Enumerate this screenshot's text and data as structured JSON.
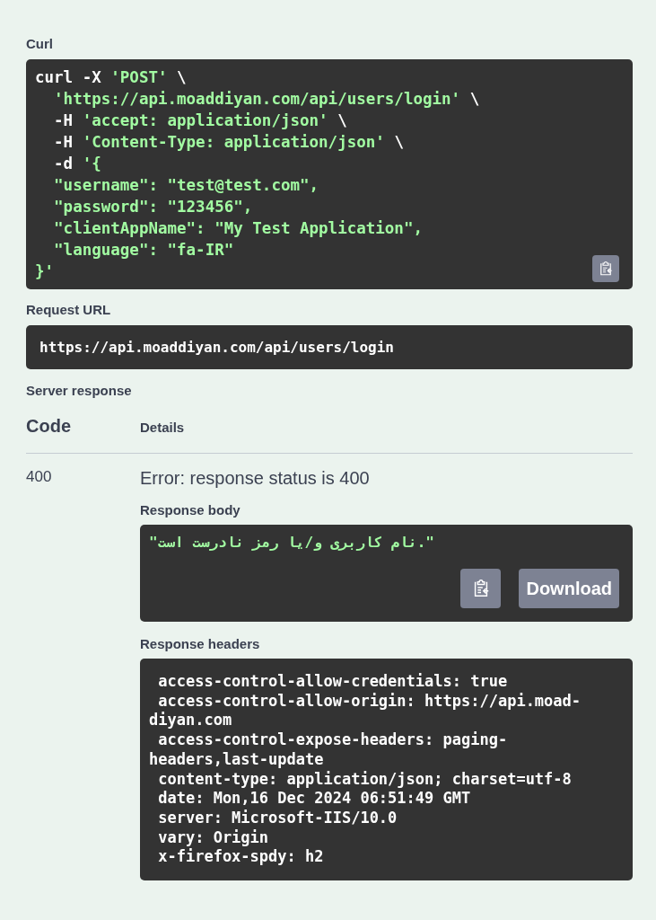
{
  "curl": {
    "label": "Curl",
    "lines": [
      [
        {
          "kind": "plain",
          "text": "curl -X "
        },
        {
          "kind": "string",
          "text": "'POST'"
        },
        {
          "kind": "plain",
          "text": " \\"
        }
      ],
      [
        {
          "kind": "string",
          "text": "  'https://api.moaddiyan.com/api/users/login'"
        },
        {
          "kind": "plain",
          "text": " \\"
        }
      ],
      [
        {
          "kind": "plain",
          "text": "  -H "
        },
        {
          "kind": "string",
          "text": "'accept: application/json'"
        },
        {
          "kind": "plain",
          "text": " \\"
        }
      ],
      [
        {
          "kind": "plain",
          "text": "  -H "
        },
        {
          "kind": "string",
          "text": "'Content-Type: application/json'"
        },
        {
          "kind": "plain",
          "text": " \\"
        }
      ],
      [
        {
          "kind": "plain",
          "text": "  -d "
        },
        {
          "kind": "string",
          "text": "'{"
        }
      ],
      [
        {
          "kind": "string",
          "text": "  \"username\": \"test@test.com\","
        }
      ],
      [
        {
          "kind": "string",
          "text": "  \"password\": \"123456\","
        }
      ],
      [
        {
          "kind": "string",
          "text": "  \"clientAppName\": \"My Test Application\","
        }
      ],
      [
        {
          "kind": "string",
          "text": "  \"language\": \"fa-IR\""
        }
      ],
      [
        {
          "kind": "string",
          "text": "}'"
        }
      ]
    ]
  },
  "request_url": {
    "label": "Request URL",
    "value": "https://api.moaddiyan.com/api/users/login"
  },
  "server_response": {
    "label": "Server response",
    "columns": [
      "Code",
      "Details"
    ],
    "rows": [
      {
        "code": "400",
        "error": "Error: response status is 400",
        "body_label": "Response body",
        "body": "\"نام کاربری و/یا رمز نادرست است.\"",
        "download": "Download",
        "headers_label": "Response headers",
        "headers": [
          " access-control-allow-credentials: true",
          " access-control-allow-origin: https://api.moad-",
          "diyan.com",
          " access-control-expose-headers: paging-",
          "headers,last-update",
          " content-type: application/json; charset=utf-8",
          " date: Mon,16 Dec 2024 06:51:49 GMT",
          " server: Microsoft-IIS/10.0",
          " vary: Origin",
          " x-firefox-spdy: h2"
        ]
      }
    ]
  }
}
